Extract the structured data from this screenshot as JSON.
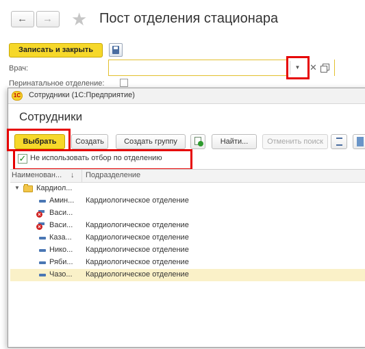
{
  "form": {
    "title": "Пост отделения стационара",
    "save_close": "Записать и закрыть",
    "vrach_label": "Врач:",
    "vrach_value": "",
    "perinatal_label": "Перинатальное отделение:",
    "clear_glyph": "✕",
    "back_glyph": "←",
    "forward_glyph": "→",
    "star_glyph": "★",
    "dropdown_glyph": "▼"
  },
  "modal": {
    "caption": "Сотрудники  (1С:Предприятие)",
    "logo": "1С",
    "title": "Сотрудники",
    "toolbar": {
      "select": "Выбрать",
      "create": "Создать",
      "create_group": "Создать группу",
      "find": "Найти...",
      "cancel_search": "Отменить поиск"
    },
    "checkbox": {
      "label": "Не использовать отбор по отделению",
      "checked": true,
      "glyph": "✓"
    },
    "table": {
      "columns": [
        "Наименован...",
        "Подразделение"
      ],
      "sort_glyph": "↓",
      "group_row": {
        "name": "Кардиол...",
        "dept": ""
      },
      "rows": [
        {
          "name": "Амин...",
          "dept": "Кардиологическое отделение",
          "deleted": false,
          "selected": false
        },
        {
          "name": "Васи...",
          "dept": "",
          "deleted": true,
          "selected": false
        },
        {
          "name": "Васи...",
          "dept": "Кардиологическое отделение",
          "deleted": true,
          "selected": false
        },
        {
          "name": "Каза...",
          "dept": "Кардиологическое отделение",
          "deleted": false,
          "selected": false
        },
        {
          "name": "Нико...",
          "dept": "Кардиологическое отделение",
          "deleted": false,
          "selected": false
        },
        {
          "name": "Ряби...",
          "dept": "Кардиологическое отделение",
          "deleted": false,
          "selected": false
        },
        {
          "name": "Чазо...",
          "dept": "Кардиологическое отделение",
          "deleted": false,
          "selected": true
        }
      ]
    }
  },
  "colors": {
    "accent_yellow": "#f6d82a",
    "highlight_red": "#e60000",
    "selected_row": "#faf1c8"
  }
}
